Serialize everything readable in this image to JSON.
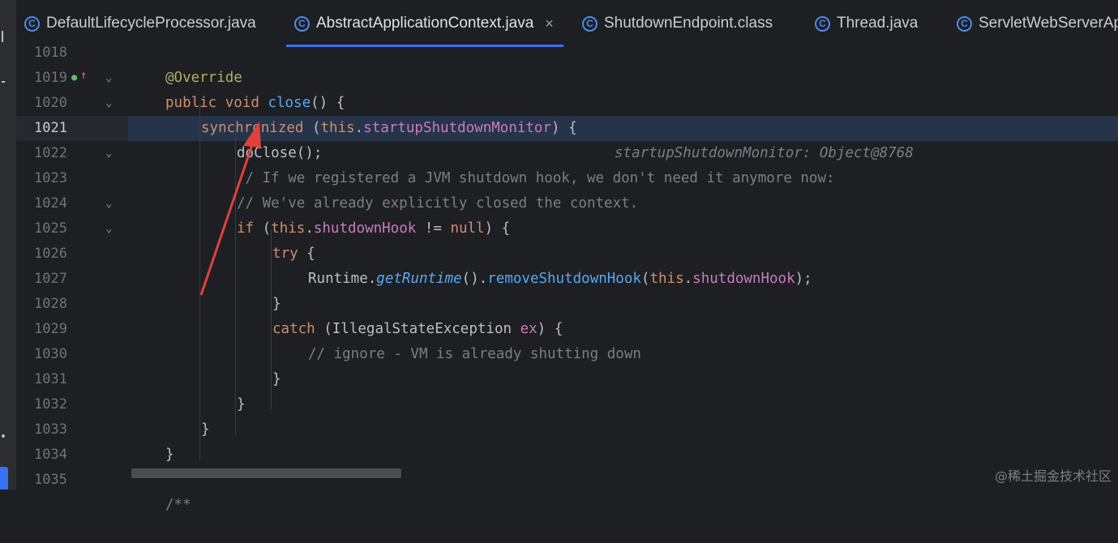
{
  "tabs": [
    {
      "label": "DefaultLifecycleProcessor.java",
      "icon": "class-c-icon"
    },
    {
      "label": "AbstractApplicationContext.java",
      "icon": "class-c-icon",
      "active": true,
      "close": "×"
    },
    {
      "label": "ShutdownEndpoint.class",
      "icon": "class-c-icon"
    },
    {
      "label": "Thread.java",
      "icon": "class-c-icon"
    },
    {
      "label": "ServletWebServerAp",
      "icon": "class-c-icon"
    }
  ],
  "lines": [
    {
      "num": "1018"
    },
    {
      "num": "1019"
    },
    {
      "num": "1020"
    },
    {
      "num": "1021"
    },
    {
      "num": "1022"
    },
    {
      "num": "1023"
    },
    {
      "num": "1024"
    },
    {
      "num": "1025"
    },
    {
      "num": "1026"
    },
    {
      "num": "1027"
    },
    {
      "num": "1028"
    },
    {
      "num": "1029"
    },
    {
      "num": "1030"
    },
    {
      "num": "1031"
    },
    {
      "num": "1032"
    },
    {
      "num": "1033"
    },
    {
      "num": "1034"
    },
    {
      "num": "1035"
    }
  ],
  "code": {
    "l1018": "@Override",
    "l1019_kw": "public void ",
    "l1019_m": "close",
    "l1019_rest": "() {",
    "l1020_kw": "synchronized",
    "l1020_a": " (",
    "l1020_this": "this",
    "l1020_dot": ".",
    "l1020_fld": "startupShutdownMonitor",
    "l1020_b": ") {",
    "l1020_hint": "startupShutdownMonitor: Object@8768",
    "l1021": "doClose();",
    "l1022": "// If we registered a JVM shutdown hook, we don't need it anymore now:",
    "l1023": "// We've already explicitly closed the context.",
    "l1024_kw": "if",
    "l1024_a": " (",
    "l1024_this": "this",
    "l1024_dot": ".",
    "l1024_fld": "shutdownHook",
    "l1024_op": " != ",
    "l1024_null": "null",
    "l1024_b": ") {",
    "l1025_kw": "try",
    "l1025_b": " {",
    "l1026_a": "Runtime.",
    "l1026_sm": "getRuntime",
    "l1026_b": "().",
    "l1026_m": "removeShutdownHook",
    "l1026_c": "(",
    "l1026_this": "this",
    "l1026_dot": ".",
    "l1026_fld": "shutdownHook",
    "l1026_d": ");",
    "l1027": "}",
    "l1028_kw": "catch",
    "l1028_a": " (IllegalStateException ",
    "l1028_v": "ex",
    "l1028_b": ") {",
    "l1029": "// ignore - VM is already shutting down",
    "l1030": "}",
    "l1031": "}",
    "l1032": "}",
    "l1033": "}",
    "l1035": "/**"
  },
  "colors": {
    "accent": "#3574f0",
    "arrow": "#e0413a"
  },
  "watermark": "@稀土掘金技术社区"
}
